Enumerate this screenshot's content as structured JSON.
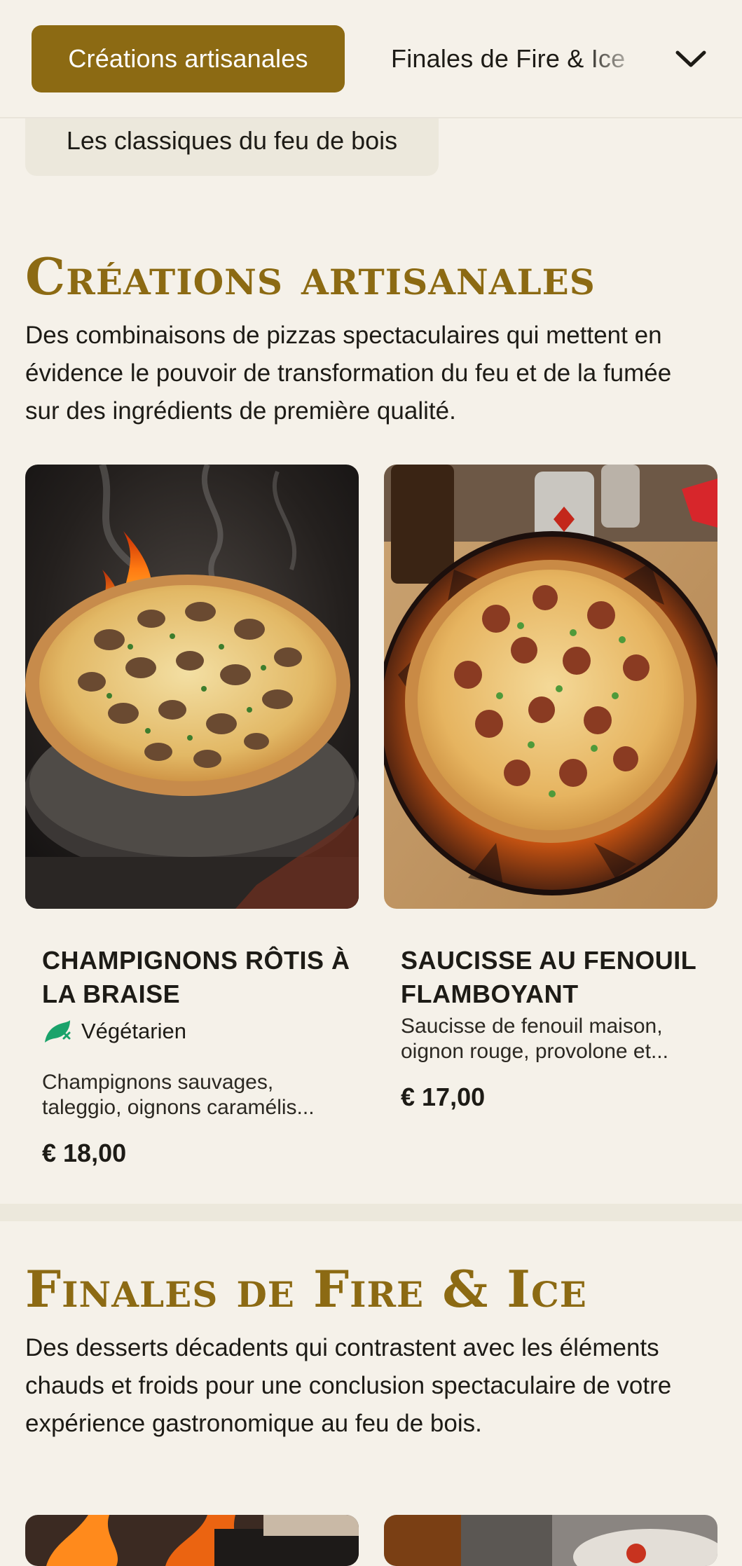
{
  "nav": {
    "active_category": "Créations artisanales",
    "next_category": "Finales de Fire & Ice",
    "previous_category": "Les classiques du feu de bois",
    "toggle_icon": "chevron-down-icon"
  },
  "sections": [
    {
      "title": "Créations artisanales",
      "description": "Des combinaisons de pizzas spectaculaires qui mettent en évidence le pouvoir de transformation du feu et de la fumée sur des ingrédients de première qualité.",
      "items": [
        {
          "name": "Champignons rôtis à la braise",
          "tag": "Végétarien",
          "tag_icon": "vegetarian-leaf-icon",
          "description_line1": "Champignons sauvages,",
          "description_line2": "taleggio, oignons caramélis...",
          "price": "€ 18,00"
        },
        {
          "name": "Saucisse au fenouil flamboyant",
          "description_line1": "Saucisse de fenouil maison,",
          "description_line2": "oignon rouge, provolone et...",
          "price": "€ 17,00"
        }
      ]
    },
    {
      "title": "Finales de Fire & Ice",
      "description": "Des desserts décadents qui contrastent avec les éléments chauds et froids pour une conclusion spectaculaire de votre expérience gastronomique au feu de bois."
    }
  ],
  "colors": {
    "background": "#f5f1e9",
    "accent_gold": "#8c6a13",
    "chip_muted": "#ece8dc",
    "vegetarian_green": "#1aa36b",
    "text": "#1d1b16"
  }
}
